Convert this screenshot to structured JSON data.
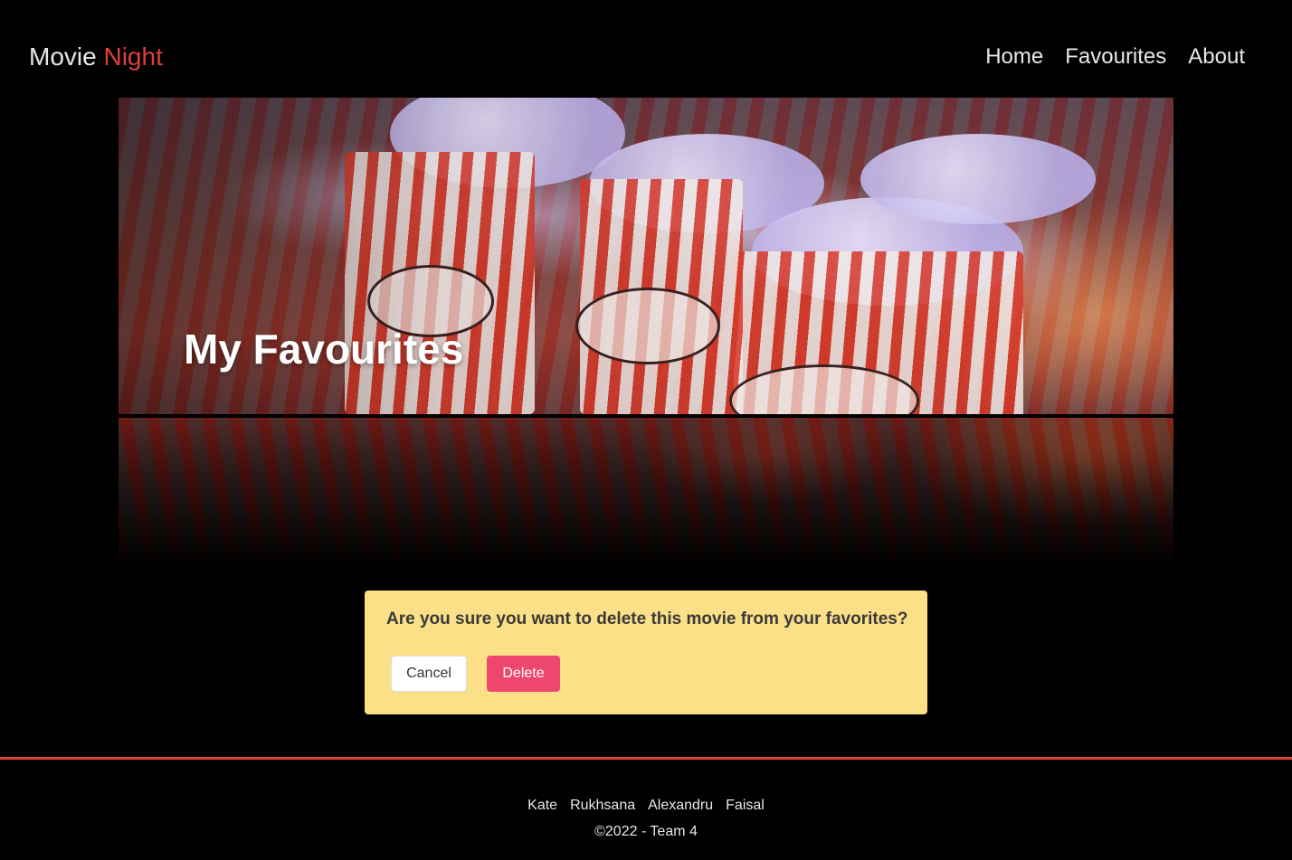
{
  "navbar": {
    "brand_main": "Movie",
    "brand_accent": "Night",
    "links": [
      {
        "label": "Home"
      },
      {
        "label": "Favourites"
      },
      {
        "label": "About"
      }
    ]
  },
  "hero": {
    "title": "My Favourites"
  },
  "alert": {
    "message": "Are you sure you want to delete this movie from your favorites?",
    "cancel_label": "Cancel",
    "delete_label": "Delete"
  },
  "footer": {
    "names": [
      "Kate",
      "Rukhsana",
      "Alexandru",
      "Faisal"
    ],
    "copyright": "©2022 - Team 4"
  },
  "colors": {
    "accent": "#e0403a",
    "alert_bg": "#fce087",
    "delete_button": "#ef4670",
    "background": "#000000"
  }
}
